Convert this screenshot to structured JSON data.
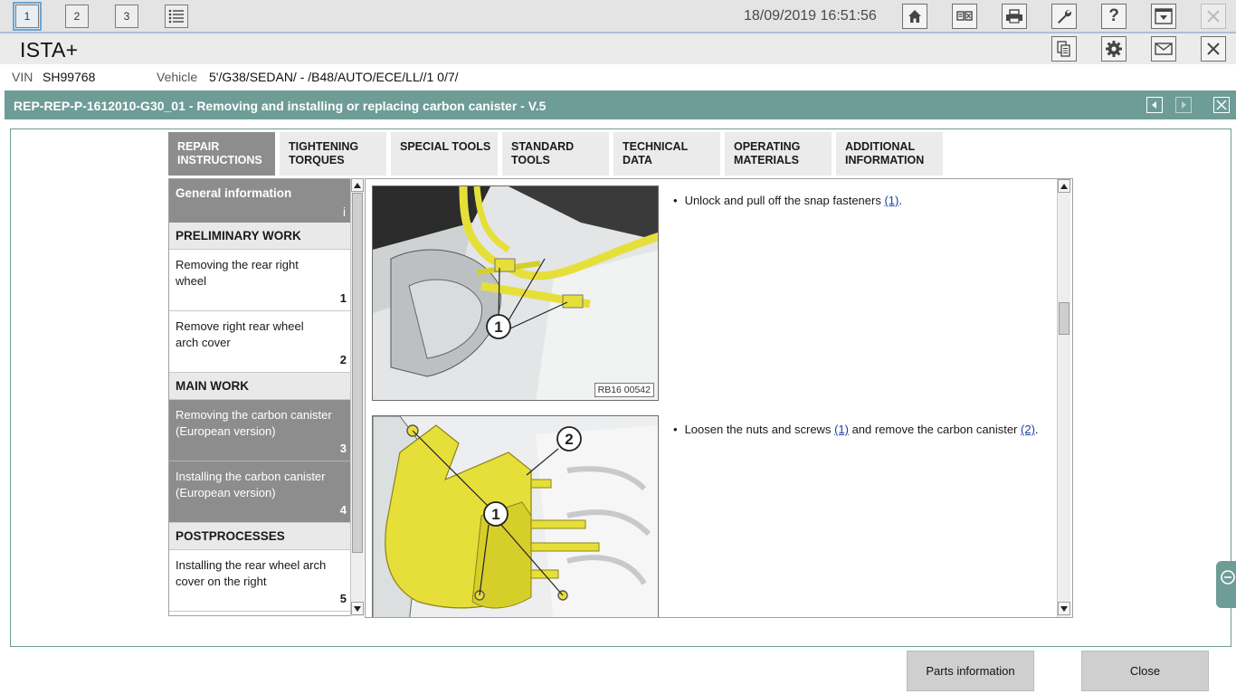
{
  "toolbar": {
    "tabs": [
      "1",
      "2",
      "3"
    ],
    "datetime": "18/09/2019 16:51:56",
    "icons": [
      "home-icon",
      "text-compare-icon",
      "printer-icon",
      "wrench-icon",
      "help-icon",
      "dropdown-panel-icon",
      "close-icon"
    ]
  },
  "app": {
    "title": "ISTA+",
    "icons": [
      "documents-icon",
      "gear-icon",
      "mail-icon",
      "close-icon"
    ]
  },
  "vehicle": {
    "vin_label": "VIN",
    "vin_value": "SH99768",
    "vehicle_label": "Vehicle",
    "vehicle_value": "5'/G38/SEDAN/ - /B48/AUTO/ECE/LL//1 0/7/"
  },
  "document": {
    "title": "REP-REP-P-1612010-G30_01 - Removing and installing or replacing carbon canister - V.5"
  },
  "tabs": [
    {
      "line1": "REPAIR",
      "line2": "INSTRUCTIONS"
    },
    {
      "line1": "TIGHTENING",
      "line2": "TORQUES"
    },
    {
      "line1": "SPECIAL TOOLS",
      "line2": ""
    },
    {
      "line1": "STANDARD",
      "line2": "TOOLS"
    },
    {
      "line1": "TECHNICAL",
      "line2": "DATA"
    },
    {
      "line1": "OPERATING",
      "line2": "MATERIALS"
    },
    {
      "line1": "ADDITIONAL",
      "line2": "INFORMATION"
    }
  ],
  "nav": {
    "general": {
      "label": "General information",
      "marker": "i"
    },
    "sections": [
      "PRELIMINARY WORK",
      "MAIN WORK",
      "POSTPROCESSES"
    ],
    "items": [
      {
        "label": "Removing the rear right wheel",
        "num": "1"
      },
      {
        "label": "Remove right rear wheel arch cover",
        "num": "2"
      },
      {
        "label": "Removing the carbon canister (European version)",
        "num": "3"
      },
      {
        "label": "Installing the carbon canister (European version)",
        "num": "4"
      },
      {
        "label": "Installing the rear wheel arch cover on the right",
        "num": "5"
      }
    ]
  },
  "steps": [
    {
      "bullet": "•",
      "text_before": "Unlock and pull off the snap fasteners ",
      "ref1": "(1)",
      "text_after": ".",
      "figure_code": "RB16 00542",
      "callouts": [
        "1"
      ]
    },
    {
      "bullet": "•",
      "text_before": "Loosen the nuts and screws ",
      "ref1": "(1)",
      "text_mid": " and remove the carbon canister ",
      "ref2": "(2)",
      "text_after": ".",
      "callouts": [
        "2",
        "1"
      ]
    }
  ],
  "buttons": {
    "parts": "Parts information",
    "close": "Close"
  },
  "colors": {
    "accent": "#6e9c97",
    "tab_active": "#8d8d8d",
    "part_yellow": "#e6df3a"
  }
}
